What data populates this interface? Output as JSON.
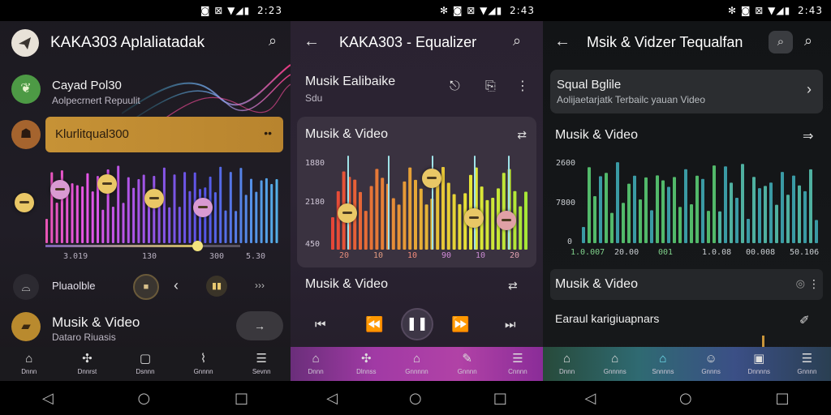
{
  "status": {
    "p1": {
      "icons": "◙ ⊠ ▼◢▮",
      "time": "2:23"
    },
    "p2": {
      "icons": "✻ ◙ ⊠ ▼◢▮",
      "time": "2:43"
    },
    "p3": {
      "icons": "✻ ◙ ⊠ ▼◢▮",
      "time": "2:43"
    }
  },
  "panel1": {
    "app_title": "KAKA303 Aplaliatadak",
    "item1": {
      "title": "Cayad Pol30",
      "subtitle": "Aolpecrnert Repuulit"
    },
    "item2": {
      "title": "Klurlitqual300"
    },
    "slider_ticks": [
      "3.019",
      "130",
      "300",
      "5.30"
    ],
    "equalizer_levels": [
      0.45,
      0.62,
      0.7,
      0.5,
      0.38
    ],
    "position": 0.78,
    "playback_label": "Pluaolble",
    "music_card": {
      "title": "Musik & Video",
      "subtitle": "Dataro Riuasis"
    },
    "nav": [
      "Dnnn",
      "Dnnrst",
      "Dsnnn",
      "Gnnnn",
      "Sevnn"
    ]
  },
  "panel2": {
    "app_title": "KAKA303 - Equalizer",
    "header_title": "Musik Ealibaike",
    "header_subtitle": "Sdu",
    "card_title": "Musik & Video",
    "y_ticks": [
      "1880",
      "2180",
      "450"
    ],
    "x_ticks": [
      "20",
      "10",
      "10",
      "90",
      "10",
      "20"
    ],
    "equalizer_levels": [
      0.35,
      0.72,
      0.3,
      0.28
    ],
    "section_title": "Musik & Video",
    "nav": [
      "Dnnn",
      "Dlnnss",
      "Gnnnnn",
      "Gnnnn",
      "Cnnnn"
    ]
  },
  "panel3": {
    "app_title": "Msik & Vidzer Tequalfan",
    "banner_title": "Squal Bglile",
    "banner_subtitle": "Aolijaetarjatk Terbailc yauan Video",
    "chart_title": "Musik & Video",
    "y_ticks": [
      "2600",
      "7800",
      "0"
    ],
    "x_ticks": [
      "1.0.007",
      "20.00",
      "001",
      "1.0.08",
      "00.008",
      "50.106"
    ],
    "section_title": "Musik & Video",
    "lower_title": "Earaul karigiuapnars",
    "nav": [
      "Dnnn",
      "Gnnnns",
      "Snnnns",
      "Gnnns",
      "Dnnnns",
      "Gnnnn"
    ]
  },
  "colors": {
    "accent_gold": "#c9953a",
    "knob_gold": "#e9c766",
    "knob_pink": "#d99ad2",
    "green_bar": "#52b96a",
    "teal_bar": "#3a9aa4"
  }
}
